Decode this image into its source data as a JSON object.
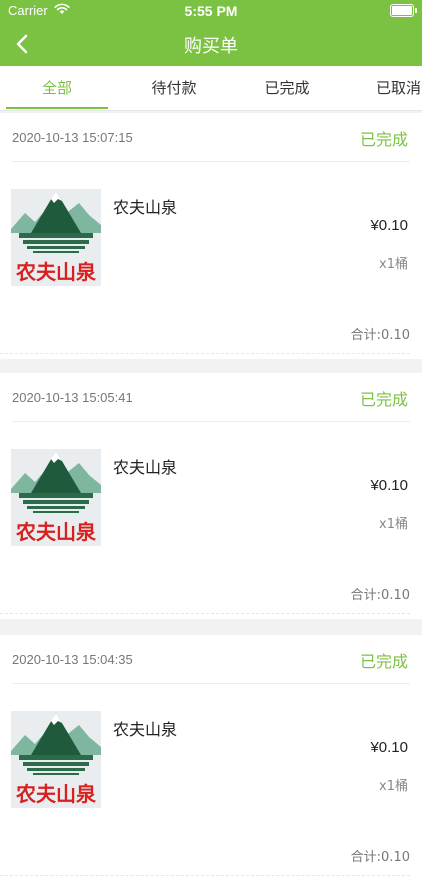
{
  "status_bar": {
    "carrier": "Carrier",
    "time": "5:55 PM",
    "battery_level": 1.0
  },
  "nav": {
    "title": "购买单",
    "back_icon": "chevron-left-icon"
  },
  "tabs": [
    {
      "label": "全部",
      "active": true
    },
    {
      "label": "待付款",
      "active": false
    },
    {
      "label": "已完成",
      "active": false
    },
    {
      "label": "已取消",
      "active": false
    }
  ],
  "orders": [
    {
      "time": "2020-10-13 15:07:15",
      "status": "已完成",
      "product": {
        "brand_logo": "农夫山泉",
        "name": "农夫山泉",
        "price": "¥0.10",
        "quantity": "x1桶"
      },
      "total": "合计:0.10"
    },
    {
      "time": "2020-10-13 15:05:41",
      "status": "已完成",
      "product": {
        "brand_logo": "农夫山泉",
        "name": "农夫山泉",
        "price": "¥0.10",
        "quantity": "x1桶"
      },
      "total": "合计:0.10"
    },
    {
      "time": "2020-10-13 15:04:35",
      "status": "已完成",
      "product": {
        "brand_logo": "农夫山泉",
        "name": "农夫山泉",
        "price": "¥0.10",
        "quantity": "x1桶"
      },
      "total": "合计:0.10"
    }
  ],
  "colors": {
    "accent": "#7cc242",
    "logo_red": "#d7201f",
    "mountain_dark": "#1f5a3d",
    "mountain_light": "#7fb6a0"
  }
}
